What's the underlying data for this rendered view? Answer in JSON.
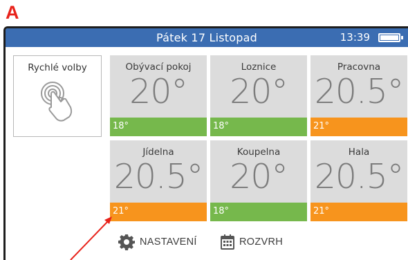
{
  "annotation": {
    "letter": "A"
  },
  "header": {
    "title": "Pátek 17 Listopad",
    "time": "13:39"
  },
  "quick_settings": {
    "label": "Rychlé volby",
    "icon": "touch-icon"
  },
  "rooms": [
    {
      "name": "Obývací pokoj",
      "temp": "20°",
      "setpoint": "18°",
      "status": "green"
    },
    {
      "name": "Loznice",
      "temp": "20°",
      "setpoint": "18°",
      "status": "green"
    },
    {
      "name": "Pracovna",
      "temp": "20.5°",
      "setpoint": "21°",
      "status": "orange"
    },
    {
      "name": "Jídelna",
      "temp": "20.5°",
      "setpoint": "21°",
      "status": "orange"
    },
    {
      "name": "Koupelna",
      "temp": "20°",
      "setpoint": "18°",
      "status": "green"
    },
    {
      "name": "Hala",
      "temp": "20.5°",
      "setpoint": "21°",
      "status": "orange"
    }
  ],
  "footer": {
    "settings_label": "NASTAVENÍ",
    "schedule_label": "ROZVRH"
  },
  "colors": {
    "header": "#3b6db2",
    "green": "#76b84c",
    "orange": "#f7941d",
    "tile": "#dcdcdc",
    "annotation": "#e8231b"
  }
}
